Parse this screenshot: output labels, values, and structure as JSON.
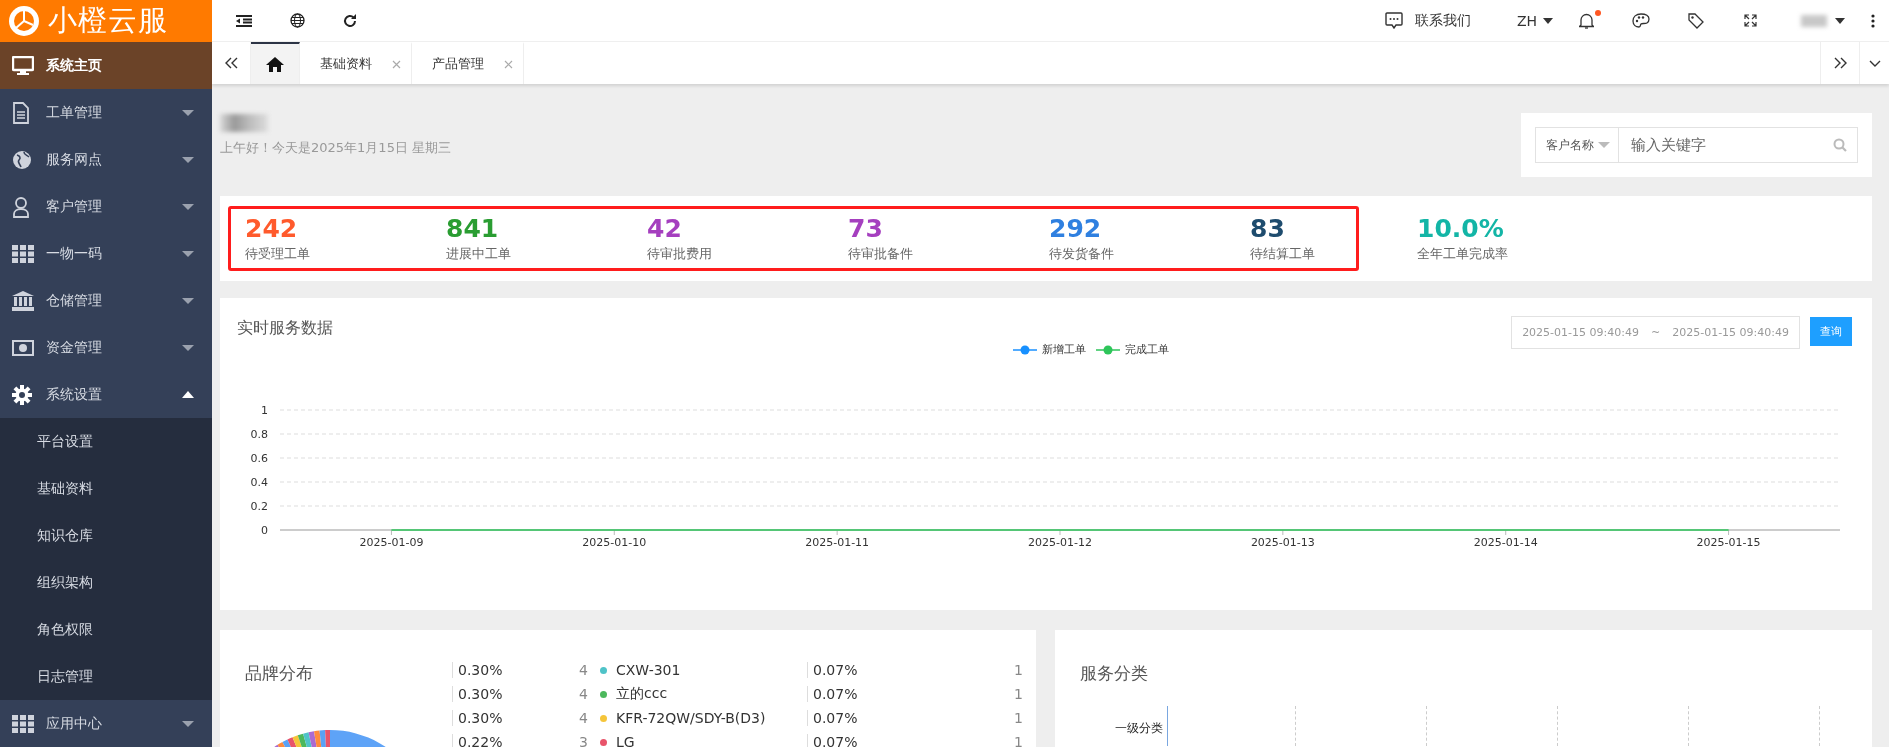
{
  "logo": {
    "text": "小橙云服"
  },
  "sidebar": {
    "items": [
      {
        "label": "系统主页",
        "selected": true
      },
      {
        "label": "工单管理",
        "selected": false,
        "expanded": false
      },
      {
        "label": "服务网点",
        "selected": false,
        "expanded": false
      },
      {
        "label": "客户管理",
        "selected": false,
        "expanded": false
      },
      {
        "label": "一物一码",
        "selected": false,
        "expanded": false
      },
      {
        "label": "仓储管理",
        "selected": false,
        "expanded": false
      },
      {
        "label": "资金管理",
        "selected": false,
        "expanded": false
      },
      {
        "label": "系统设置",
        "selected": false,
        "expanded": true,
        "children": [
          {
            "label": "平台设置",
            "selected": false
          },
          {
            "label": "基础资料",
            "selected": false
          },
          {
            "label": "知识仓库",
            "selected": false
          },
          {
            "label": "组织架构",
            "selected": false
          },
          {
            "label": "角色权限",
            "selected": false
          },
          {
            "label": "日志管理",
            "selected": false
          }
        ]
      },
      {
        "label": "应用中心",
        "selected": false,
        "expanded": false
      }
    ]
  },
  "topbar": {
    "contact": "联系我们",
    "language": "ZH",
    "has_notification": true
  },
  "tabs": [
    {
      "kind": "home",
      "selected": true
    },
    {
      "kind": "page",
      "label": "基础资料",
      "selected": false
    },
    {
      "kind": "page",
      "label": "产品管理",
      "selected": false
    }
  ],
  "greeting": {
    "text": "上午好！今天是2025年1月15日 星期三"
  },
  "search": {
    "filter": "客户名称",
    "placeholder": "输入关键字"
  },
  "stats": [
    {
      "value": "242",
      "label": "待受理工单",
      "color": "#ff5a2c",
      "framed": true
    },
    {
      "value": "841",
      "label": "进展中工单",
      "color": "#2a9d32",
      "framed": true
    },
    {
      "value": "42",
      "label": "待审批费用",
      "color": "#a53fbf",
      "framed": true
    },
    {
      "value": "73",
      "label": "待审批备件",
      "color": "#a53fbf",
      "framed": true
    },
    {
      "value": "292",
      "label": "待发货备件",
      "color": "#2f80e0",
      "framed": true
    },
    {
      "value": "83",
      "label": "待结算工单",
      "color": "#1e4c6e",
      "framed": true
    },
    {
      "value": "10.0%",
      "label": "全年工单完成率",
      "color": "#13b5a6",
      "framed": false
    }
  ],
  "realtime": {
    "title": "实时服务数据",
    "date_from": "2025-01-15 09:40:49",
    "separator": "~",
    "date_to": "2025-01-15 09:40:49",
    "query_button": "查询",
    "chart_data": {
      "type": "line",
      "grid": true,
      "categories": [
        "2025-01-09",
        "2025-01-10",
        "2025-01-11",
        "2025-01-12",
        "2025-01-13",
        "2025-01-14",
        "2025-01-15"
      ],
      "ylim": [
        0,
        1
      ],
      "yticks": [
        0,
        0.2,
        0.4,
        0.6,
        0.8,
        1
      ],
      "series": [
        {
          "name": "新增工单",
          "color": "#1890ff",
          "values": [
            null,
            null,
            null,
            null,
            null,
            null,
            null
          ]
        },
        {
          "name": "完成工单",
          "color": "#2ec55a",
          "values": [
            0,
            0,
            0,
            0,
            0,
            0,
            0
          ]
        }
      ]
    }
  },
  "brand": {
    "title": "品牌分布",
    "rows": [
      {
        "percent": "0.30%",
        "count": "4",
        "color": "#4fc3c8",
        "name": "CXW-301"
      },
      {
        "percent": "0.30%",
        "count": "4",
        "color": "#4cb85c",
        "name": "立的ccc"
      },
      {
        "percent": "0.30%",
        "count": "4",
        "color": "#f5c53a",
        "name": "KFR-72QW/SDY-B(D3)"
      },
      {
        "percent": "0.22%",
        "count": "3",
        "color": "#e8546a",
        "name": "LG"
      }
    ],
    "rows_2": [
      {
        "percent": "0.07%",
        "count": "1"
      },
      {
        "percent": "0.07%",
        "count": "1"
      },
      {
        "percent": "0.07%",
        "count": "1"
      },
      {
        "percent": "0.07%",
        "count": "1"
      }
    ]
  },
  "service": {
    "title": "服务分类",
    "categories": [
      "一级分类"
    ]
  }
}
